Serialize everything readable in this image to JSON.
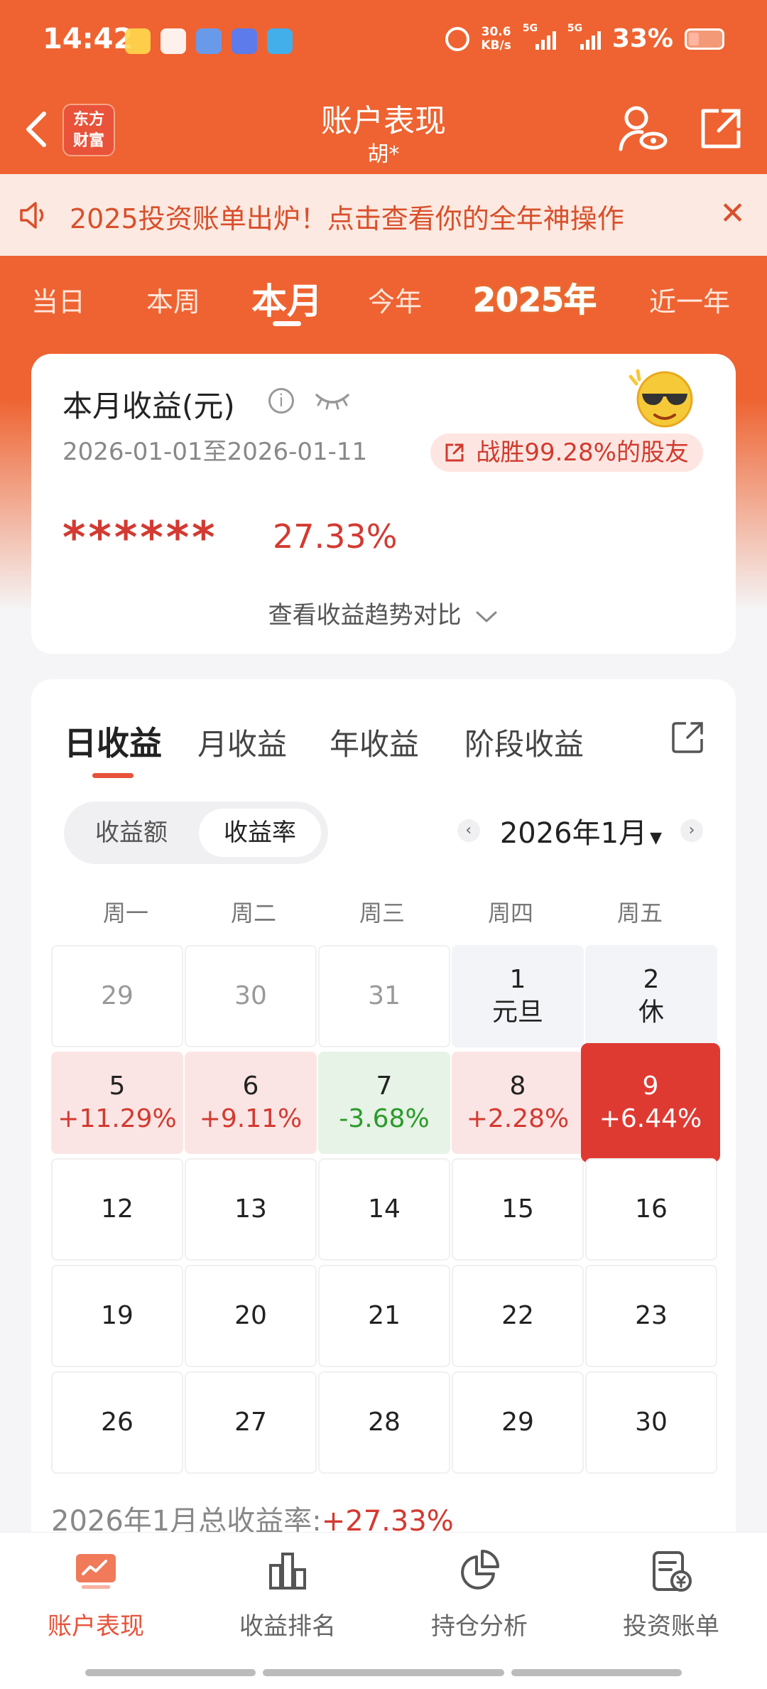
{
  "status_bar": {
    "time": "14:42",
    "net_speed_value": "30.6",
    "net_speed_unit": "KB/s",
    "sim1": "5G",
    "sim2": "5G",
    "battery": "33%"
  },
  "header": {
    "logo_line1": "东方",
    "logo_line2": "财富",
    "title": "账户表现",
    "subtitle": "胡*"
  },
  "notice": {
    "text": "2025投资账单出炉！点击查看你的全年神操作"
  },
  "period_tabs": [
    "当日",
    "本周",
    "本月",
    "今年",
    "2025年",
    "近一年"
  ],
  "summary": {
    "title": "本月收益(元)",
    "info_glyph": "i",
    "date_range": "2026-01-01至2026-01-11",
    "beat_text": "战胜99.28%的股友",
    "masked_value": "******",
    "pct": "27.33%",
    "trend_link": "查看收益趋势对比"
  },
  "profit_tabs": [
    "日收益",
    "月收益",
    "年收益",
    "阶段收益"
  ],
  "toggle": {
    "option1": "收益额",
    "option2": "收益率"
  },
  "month_nav": {
    "prev": "‹",
    "label": "2026年1月",
    "next": "›"
  },
  "weekdays": [
    "周一",
    "周二",
    "周三",
    "周四",
    "周五"
  ],
  "calendar_rows": [
    [
      {
        "day": "29",
        "sub": ""
      },
      {
        "day": "30",
        "sub": ""
      },
      {
        "day": "31",
        "sub": ""
      },
      {
        "day": "1",
        "sub": "元旦"
      },
      {
        "day": "2",
        "sub": "休"
      }
    ],
    [
      {
        "day": "5",
        "sub": "+11.29%"
      },
      {
        "day": "6",
        "sub": "+9.11%"
      },
      {
        "day": "7",
        "sub": "-3.68%"
      },
      {
        "day": "8",
        "sub": "+2.28%"
      },
      {
        "day": "9",
        "sub": "+6.44%"
      }
    ],
    [
      {
        "day": "12",
        "sub": ""
      },
      {
        "day": "13",
        "sub": ""
      },
      {
        "day": "14",
        "sub": ""
      },
      {
        "day": "15",
        "sub": ""
      },
      {
        "day": "16",
        "sub": ""
      }
    ],
    [
      {
        "day": "19",
        "sub": ""
      },
      {
        "day": "20",
        "sub": ""
      },
      {
        "day": "21",
        "sub": ""
      },
      {
        "day": "22",
        "sub": ""
      },
      {
        "day": "23",
        "sub": ""
      }
    ],
    [
      {
        "day": "26",
        "sub": ""
      },
      {
        "day": "27",
        "sub": ""
      },
      {
        "day": "28",
        "sub": ""
      },
      {
        "day": "29",
        "sub": ""
      },
      {
        "day": "30",
        "sub": ""
      }
    ]
  ],
  "total": {
    "label": "2026年1月总收益率:",
    "value": "+27.33%"
  },
  "bottom_nav": [
    "账户表现",
    "收益排名",
    "持仓分析",
    "投资账单"
  ],
  "colors": {
    "brand": "#ee6331",
    "gain": "#d33a31",
    "loss": "#2a9a2a"
  }
}
